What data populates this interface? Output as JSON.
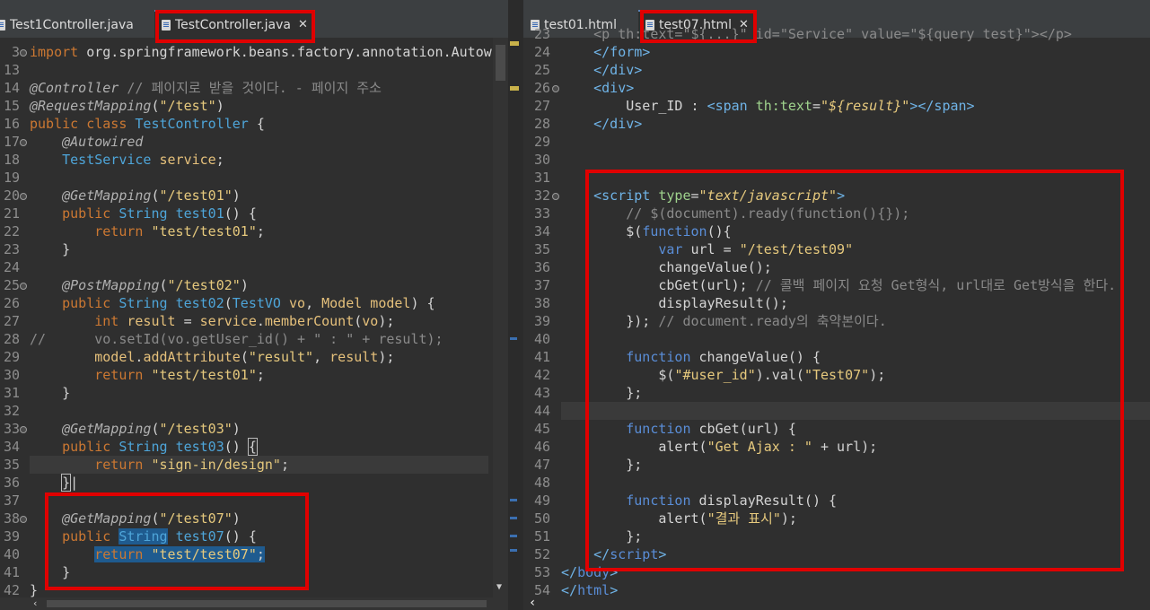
{
  "left": {
    "tabs": [
      {
        "label": "Test1Controller.java",
        "active": false
      },
      {
        "label": "TestController.java",
        "active": true
      }
    ],
    "close_glyph": "✕",
    "lines": [
      {
        "n": "3",
        "fold": true,
        "html": "<span class='kw'>import</span> org.springframework.beans.factory.annotation.Autow"
      },
      {
        "n": "13",
        "html": ""
      },
      {
        "n": "14",
        "html": "<span class='an'>@Controller</span> <span class='cm'>// 페이지로 받을 것이다. - 페이지 주소</span>"
      },
      {
        "n": "15",
        "html": "<span class='an'>@RequestMapping</span>(<span class='str'>\"/test\"</span>)"
      },
      {
        "n": "16",
        "html": "<span class='kw'>public class</span> <span class='ty'>TestController</span> {"
      },
      {
        "n": "17",
        "fold": true,
        "html": "    <span class='an'>@Autowired</span>"
      },
      {
        "n": "18",
        "html": "    <span class='ty'>TestService</span> <span class='fld'>service</span>;"
      },
      {
        "n": "19",
        "html": ""
      },
      {
        "n": "20",
        "fold": true,
        "html": "    <span class='an'>@GetMapping</span>(<span class='str'>\"/test01\"</span>)"
      },
      {
        "n": "21",
        "html": "    <span class='kw'>public</span> <span class='ty'>String</span> <span class='ty'>test01</span>() {"
      },
      {
        "n": "22",
        "html": "        <span class='kw'>return</span> <span class='str'>\"test/test01\"</span>;"
      },
      {
        "n": "23",
        "html": "    }"
      },
      {
        "n": "24",
        "html": ""
      },
      {
        "n": "25",
        "fold": true,
        "html": "    <span class='an'>@PostMapping</span>(<span class='str'>\"/test02\"</span>)"
      },
      {
        "n": "26",
        "html": "    <span class='kw'>public</span> <span class='ty'>String</span> <span class='ty'>test02</span>(<span class='ty'>TestVO</span> <span class='fld'>vo</span>, <span class='fld'>Model model</span>) {"
      },
      {
        "n": "27",
        "html": "        <span class='kw'>int</span> <span class='fld'>result</span> = <span class='fld'>service</span>.<span class='fld'>memberCount</span>(<span class='fld'>vo</span>);"
      },
      {
        "n": "28",
        "html": "<span class='cm'>//      vo.setId(vo.getUser_id() + \" : \" + result);</span>"
      },
      {
        "n": "29",
        "html": "        <span class='fld'>model</span>.<span class='fld'>addAttribute</span>(<span class='str'>\"result\"</span>, <span class='fld'>result</span>);"
      },
      {
        "n": "30",
        "html": "        <span class='kw'>return</span> <span class='str'>\"test/test01\"</span>;"
      },
      {
        "n": "31",
        "html": "    }"
      },
      {
        "n": "32",
        "html": ""
      },
      {
        "n": "33",
        "fold": true,
        "html": "    <span class='an'>@GetMapping</span>(<span class='str'>\"/test03\"</span>)"
      },
      {
        "n": "34",
        "html": "    <span class='kw'>public</span> <span class='ty'>String</span> <span class='ty'>test03</span>() <span style='outline:1px solid #bbb'>{</span>"
      },
      {
        "n": "35",
        "html": "        <span class='kw'>return</span> <span class='str'>\"sign-in/design\"</span>;"
      },
      {
        "n": "36",
        "html": "    <span style='outline:1px solid #bbb'>}</span>|"
      },
      {
        "n": "37",
        "html": ""
      },
      {
        "n": "38",
        "fold": true,
        "html": "    <span class='an'>@GetMapping</span>(<span class='str'>\"/test07\"</span>)"
      },
      {
        "n": "39",
        "html": "    <span class='kw'>public</span> <span class='sel'><span class='ty'>String</span></span> <span class='ty'>test07</span>() {"
      },
      {
        "n": "40",
        "html": "        <span class='sel'><span class='kw'>return</span> <span class='str'>\"test/test07\"</span>;</span>"
      },
      {
        "n": "41",
        "html": "    }"
      },
      {
        "n": "42",
        "html": "}"
      }
    ]
  },
  "right": {
    "tabs": [
      {
        "label": "test01.html",
        "active": false
      },
      {
        "label": "test07.html",
        "active": true
      }
    ],
    "lines": [
      {
        "n": "23",
        "html": "    <span class='cm'>&lt;p th:text=\"${...}\" id=\"Service\" value=\"${query test}\"&gt;&lt;/p&gt;</span>"
      },
      {
        "n": "24",
        "html": "    <span class='tag'>&lt;/form&gt;</span>"
      },
      {
        "n": "25",
        "html": "    <span class='tag'>&lt;/div&gt;</span>"
      },
      {
        "n": "26",
        "fold": true,
        "html": "    <span class='tag'>&lt;div&gt;</span>"
      },
      {
        "n": "27",
        "html": "        User_ID : <span class='tag'>&lt;span</span> <span class='attr'>th:text</span>=<span class='aval'>\"${result}\"</span><span class='tag'>&gt;&lt;/span&gt;</span>"
      },
      {
        "n": "28",
        "html": "    <span class='tag'>&lt;/div&gt;</span>"
      },
      {
        "n": "29",
        "html": ""
      },
      {
        "n": "30",
        "html": ""
      },
      {
        "n": "31",
        "html": ""
      },
      {
        "n": "32",
        "fold": true,
        "html": "    <span class='tag'>&lt;script</span> <span class='attr'>type</span>=<span class='aval'>\"text/javascript\"</span><span class='tag'>&gt;</span>"
      },
      {
        "n": "33",
        "html": "        <span class='cm'>// $(document).ready(function(){});</span>"
      },
      {
        "n": "34",
        "html": "        $(<span class='jkw'>function</span>(){"
      },
      {
        "n": "35",
        "html": "            <span class='jkw'>var</span> url = <span class='str'>\"/test/test09\"</span>"
      },
      {
        "n": "36",
        "html": "            changeValue();"
      },
      {
        "n": "37",
        "html": "            cbGet(url); <span class='cm'>// 콜백 페이지 요청 Get형식, url대로 Get방식을 한다.</span>"
      },
      {
        "n": "38",
        "html": "            displayResult();"
      },
      {
        "n": "39",
        "html": "        }); <span class='cm'>// document.ready의 축약본이다.</span>"
      },
      {
        "n": "40",
        "html": ""
      },
      {
        "n": "41",
        "html": "        <span class='jkw'>function</span> changeValue() {"
      },
      {
        "n": "42",
        "html": "            $(<span class='str'>\"#user_id\"</span>).val(<span class='str'>\"Test07\"</span>);"
      },
      {
        "n": "43",
        "html": "        };"
      },
      {
        "n": "44",
        "html": ""
      },
      {
        "n": "45",
        "html": "        <span class='jkw'>function</span> cbGet(url) {"
      },
      {
        "n": "46",
        "html": "            alert(<span class='str'>\"Get Ajax : \"</span> + url);"
      },
      {
        "n": "47",
        "html": "        };"
      },
      {
        "n": "48",
        "html": ""
      },
      {
        "n": "49",
        "html": "        <span class='jkw'>function</span> displayResult() {"
      },
      {
        "n": "50",
        "html": "            alert(<span class='str'>\"결과 표시\"</span>);"
      },
      {
        "n": "51",
        "html": "        };"
      },
      {
        "n": "52",
        "html": "    <span class='tag'>&lt;/</span><span class='jkw'>script</span><span class='tag'>&gt;</span>"
      },
      {
        "n": "53",
        "html": "<span class='tag'>&lt;/</span><span class='jkw'>body</span><span class='tag'>&gt;</span>"
      },
      {
        "n": "54",
        "html": "<span class='tag'>&lt;/</span><span class='jkw'>html</span><span class='tag'>&gt;</span>"
      }
    ]
  }
}
